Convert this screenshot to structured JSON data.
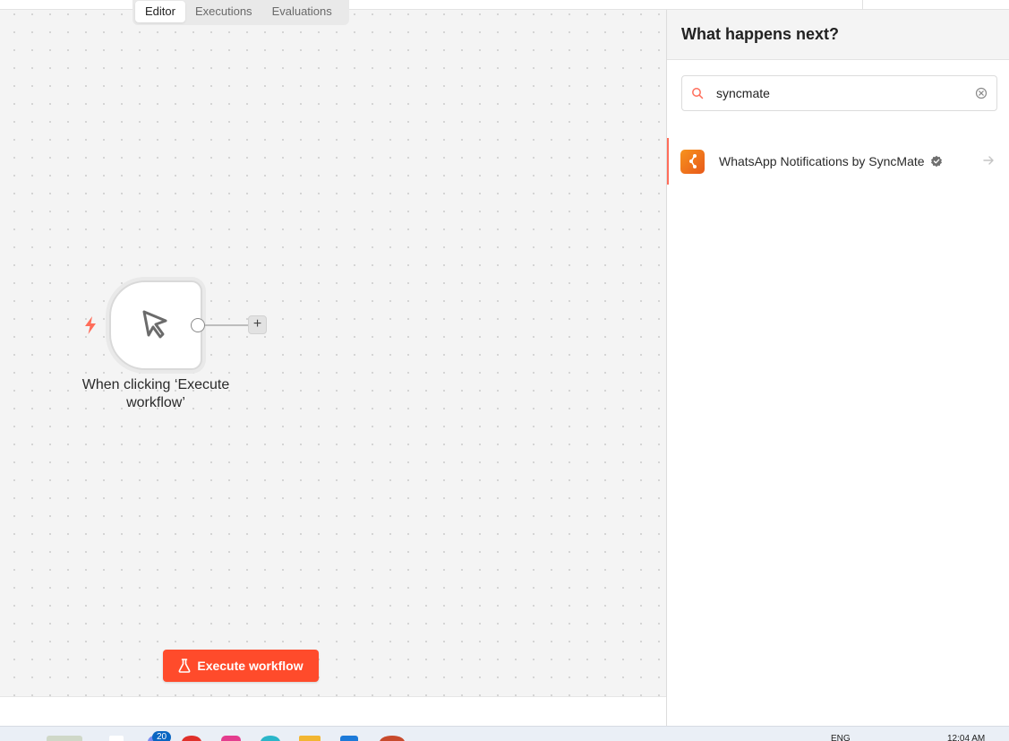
{
  "view_tabs": [
    {
      "label": "Editor",
      "active": true
    },
    {
      "label": "Executions",
      "active": false
    },
    {
      "label": "Evaluations",
      "active": false
    }
  ],
  "node": {
    "label": "When clicking ‘Execute workflow’",
    "icon": "cursor-pointer-icon",
    "trigger_icon": "lightning-bolt-icon",
    "add_symbol": "+"
  },
  "execute_button": {
    "label": "Execute workflow",
    "icon": "flask-icon",
    "color": "#ff4b2b"
  },
  "panel": {
    "title": "What happens next?",
    "search": {
      "value": "syncmate",
      "icon": "search-icon",
      "clear_icon": "clear-circle-icon"
    },
    "results": [
      {
        "label": "WhatsApp Notifications by SyncMate",
        "verified": true,
        "icon": "syncmate-logo-icon",
        "accent": "#f7931e"
      }
    ]
  },
  "taskbar": {
    "badge": "20",
    "lang": "ENG",
    "time": "12:04 AM"
  },
  "colors": {
    "accent": "#ff6d5a",
    "canvas_bg": "#f4f4f4"
  }
}
